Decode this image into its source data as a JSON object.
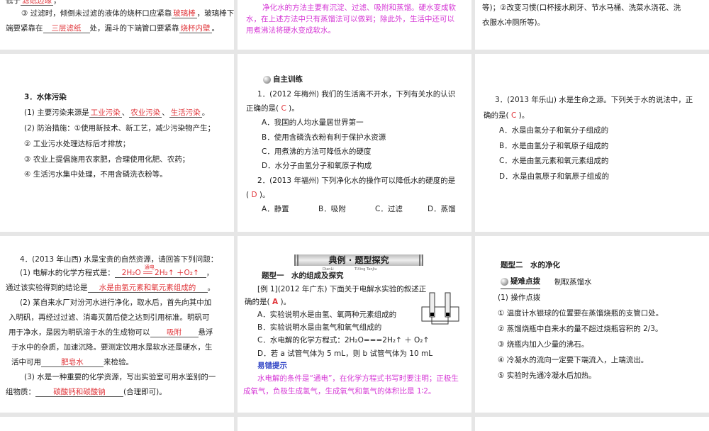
{
  "s1": {
    "l0_pre": "低于",
    "l0_ans": "滤纸边缘",
    "l0_post": "；",
    "l1_pre": "③ 过滤时，倾倒未过滤的液体的烧杯口应紧靠",
    "l1_ans": "玻璃棒",
    "l1_post": "，玻璃棒下",
    "l2_pre": "端要紧靠在",
    "l2_ans": "三层滤纸",
    "l2_mid": "处，漏斗的下端管口要紧靠",
    "l2_ans2": "烧杯内壁",
    "l2_post": "。"
  },
  "s2": {
    "l1": "净化水的方法主要有沉淀、过滤、吸附和蒸馏。硬水变成软",
    "l2": "水，在上述方法中只有蒸馏法可以做到；除此外，生活中还可以",
    "l3": "用煮沸法将硬水变成软水。"
  },
  "s3": {
    "l1": "等)；②改变习惯(口杯接水刷牙、节水马桶、洗菜水浇花、洗",
    "l2": "衣服水冲厕所等)。"
  },
  "s4": {
    "title": "3．水体污染",
    "l1_pre": "(1) 主要污染来源是",
    "a1": "工业污染",
    "sep1": "、",
    "a2": "农业污染",
    "sep2": "、",
    "a3": "生活污染",
    "l1_post": "。",
    "l2": "(2) 防治措施：①使用新技术、新工艺，减少污染物产生；",
    "l3": "② 工业污水处理达标后才排放；",
    "l4": "③ 农业上提倡施用农家肥，合理使用化肥、农药；",
    "l5": "④ 生活污水集中处理，不用含磷洗衣粉等。"
  },
  "s5": {
    "badge": "自主训练",
    "q1a": "1．(2012 年梅州) 我们的生活离不开水，下列有关水的认识",
    "q1b_pre": "正确的是(",
    "q1_ans": "C",
    "q1b_post": ")。",
    "q1_opts": [
      "A．我国的人均水量居世界第一",
      "B．使用含磷洗衣粉有利于保护水资源",
      "C．用煮沸的方法可降低水的硬度",
      "D．水分子由氢分子和氧原子构成"
    ],
    "q2a": "2．(2013 年福州) 下列净化水的操作可以降低水的硬度的是",
    "q2b_pre": "(",
    "q2_ans": "D",
    "q2b_post": ")。",
    "q2_opts": [
      "A．静置",
      "B．吸附",
      "C．过滤",
      "D．蒸馏"
    ]
  },
  "s6": {
    "q3a": "3．(2013 年乐山) 水是生命之源。下列关于水的说法中，正",
    "q3b_pre": "确的是(",
    "q3_ans": "C",
    "q3b_post": ")。",
    "opts": [
      "A．水是由氢分子和氧分子组成的",
      "B．水是由氢分子和氧原子组成的",
      "C．水是由氢元素和氧元素组成的",
      "D．水是由氢原子和氧原子组成的"
    ]
  },
  "s7": {
    "l1": "4．(2013 年山西) 水是宝贵的自然资源，请回答下列问题：",
    "l2_pre": "(1) 电解水的化学方程式是：",
    "eq": "2H₂O ══ 2H₂↑ ＋O₂↑",
    "eq_cond": "通电",
    "l2_post": "，",
    "l3_pre": "通过该实验得到的结论是",
    "a_concl": "水是由氢元素和氧元素组成的",
    "l3_post": "。",
    "l4": "(2) 某自来水厂对汾河水进行净化，取水后，首先向其中加",
    "l5": "入明矾，再经过过滤、消毒灭菌后使之达到引用标准。明矾可",
    "l6_pre": "用于净水，是因为明矾溶于水的生成物可以",
    "a_ads": "吸附",
    "l6_post": "悬浮",
    "l7": "于水中的杂质，加速沉降。要测定饮用水是软水还是硬水，生",
    "l8_pre": "活中可用",
    "a_soap": "肥皂水",
    "l8_post": "来检验。",
    "l9": "(3) 水是一种重要的化学资源，写出实验室可用水鉴别的一",
    "l10_pre": "组物质：",
    "a_pair": "碳酸钙和碳酸钠",
    "l10_post": "(合理即可)。"
  },
  "s8": {
    "banner": "典例 · 题型探究",
    "banner_sub1": "DianLi",
    "banner_sub2": "TiXing TanJiu",
    "type1": "题型一　水的组成及探究",
    "ex_a": "[例 1](2012 年广东) 下面关于电解水实验的叙述正",
    "ex_b_pre": "确的是(",
    "ex_ans": "A",
    "ex_b_post": ")。",
    "opts": [
      "A．实验说明水是由氢、氧两种元素组成的",
      "B．实验说明水是由氢气和氧气组成的",
      "C．水电解的化学方程式：2H₂O===2H₂↑ ＋ O₂↑",
      "D．若 a 试管气体为 5 mL，则 b 试管气体为 10 mL"
    ],
    "tip_title": "易错提示",
    "tip1": "水电解的条件是“通电”，在化学方程式书写时要注明；正极生",
    "tip2": "成氧气，负极生成氢气，生成氧气和氢气的体积比是 1∶2。"
  },
  "s9": {
    "type2": "题型二　水的净化",
    "badge": "疑难点拨",
    "badge_topic": "制取蒸馏水",
    "h1": "(1) 操作点拨",
    "items": [
      "① 温度计水银球的位置要在蒸馏烧瓶的支管口处。",
      "② 蒸馏烧瓶中自来水的量不超过烧瓶容积的 2/3。",
      "③ 烧瓶内加入少量的沸石。",
      "④ 冷凝水的流向一定要下端流入，上端流出。",
      "⑤ 实验时先通冷凝水后加热。"
    ]
  }
}
